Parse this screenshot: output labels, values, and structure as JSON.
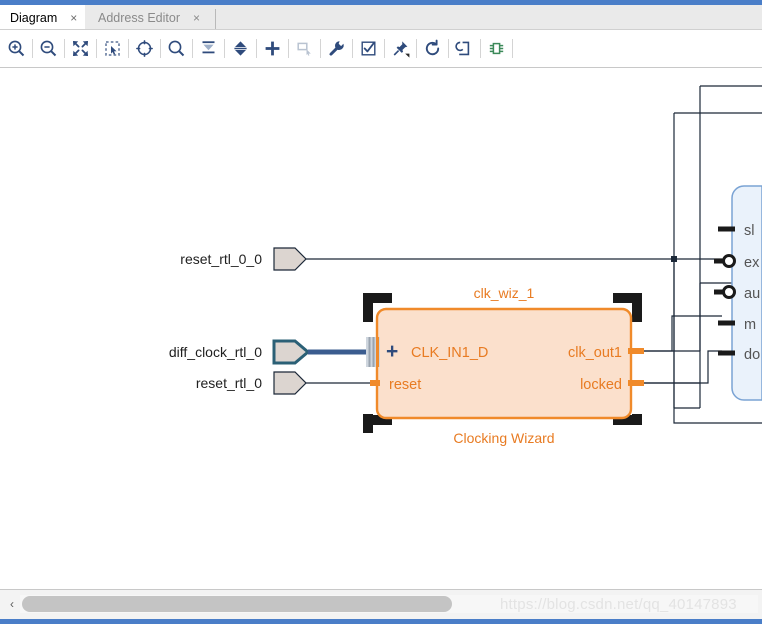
{
  "window": {
    "accent_color": "#4a7ec8"
  },
  "tabs": [
    {
      "label": "Diagram",
      "close": "×",
      "active": true
    },
    {
      "label": "Address Editor",
      "close": "×",
      "active": false
    }
  ],
  "toolbar": {
    "buttons": [
      {
        "name": "zoom-in-icon",
        "title": "Zoom In"
      },
      {
        "name": "zoom-out-icon",
        "title": "Zoom Out"
      },
      {
        "name": "zoom-fit-icon",
        "title": "Zoom Fit"
      },
      {
        "name": "zoom-selection-icon",
        "title": "Zoom Selection"
      },
      {
        "name": "refit-icon",
        "title": "Refit"
      },
      {
        "name": "search-icon",
        "title": "Search"
      },
      {
        "name": "collapse-icon",
        "title": "Collapse All"
      },
      {
        "name": "expand-icon",
        "title": "Expand All"
      },
      {
        "name": "add-ip-icon",
        "title": "Add IP"
      },
      {
        "name": "add-module-icon",
        "title": "Add Module"
      },
      {
        "name": "run-connection-automation-icon",
        "title": "Run Connection Automation"
      },
      {
        "name": "validate-design-icon",
        "title": "Validate Design"
      },
      {
        "name": "pin-icon",
        "title": "Pin"
      },
      {
        "name": "regenerate-layout-icon",
        "title": "Regenerate Layout"
      },
      {
        "name": "optimize-routing-icon",
        "title": "Optimize Routing"
      },
      {
        "name": "hierarchy-icon",
        "title": "Hierarchy"
      }
    ]
  },
  "diagram": {
    "external_ports": [
      {
        "label": "reset_rtl_0_0",
        "kind": "input",
        "selected": false
      },
      {
        "label": "diff_clock_rtl_0",
        "kind": "input",
        "selected": true
      },
      {
        "label": "reset_rtl_0",
        "kind": "input",
        "selected": false
      }
    ],
    "selected_block": {
      "name": "clk_wiz_1",
      "subtitle": "Clocking Wizard",
      "inputs": [
        {
          "label": "CLK_IN1_D",
          "bus": true,
          "expander": "+"
        },
        {
          "label": "reset",
          "bus": false
        }
      ],
      "outputs": [
        {
          "label": "clk_out1"
        },
        {
          "label": "locked"
        }
      ],
      "fill_color": "#fbe0cc",
      "border_color": "#f08a2a"
    },
    "right_block": {
      "clipped": true,
      "fill_color": "#eaf2fb",
      "border_color": "#7aa3d4",
      "pins": [
        {
          "label": "sl",
          "inverted": false
        },
        {
          "label": "ex",
          "inverted": true
        },
        {
          "label": "au",
          "inverted": true
        },
        {
          "label": "m",
          "inverted": false
        },
        {
          "label": "do",
          "inverted": false
        }
      ]
    }
  },
  "scrollbar": {
    "left_arrow": "‹"
  },
  "watermark": {
    "text": "https://blog.csdn.net/qq_40147893"
  }
}
